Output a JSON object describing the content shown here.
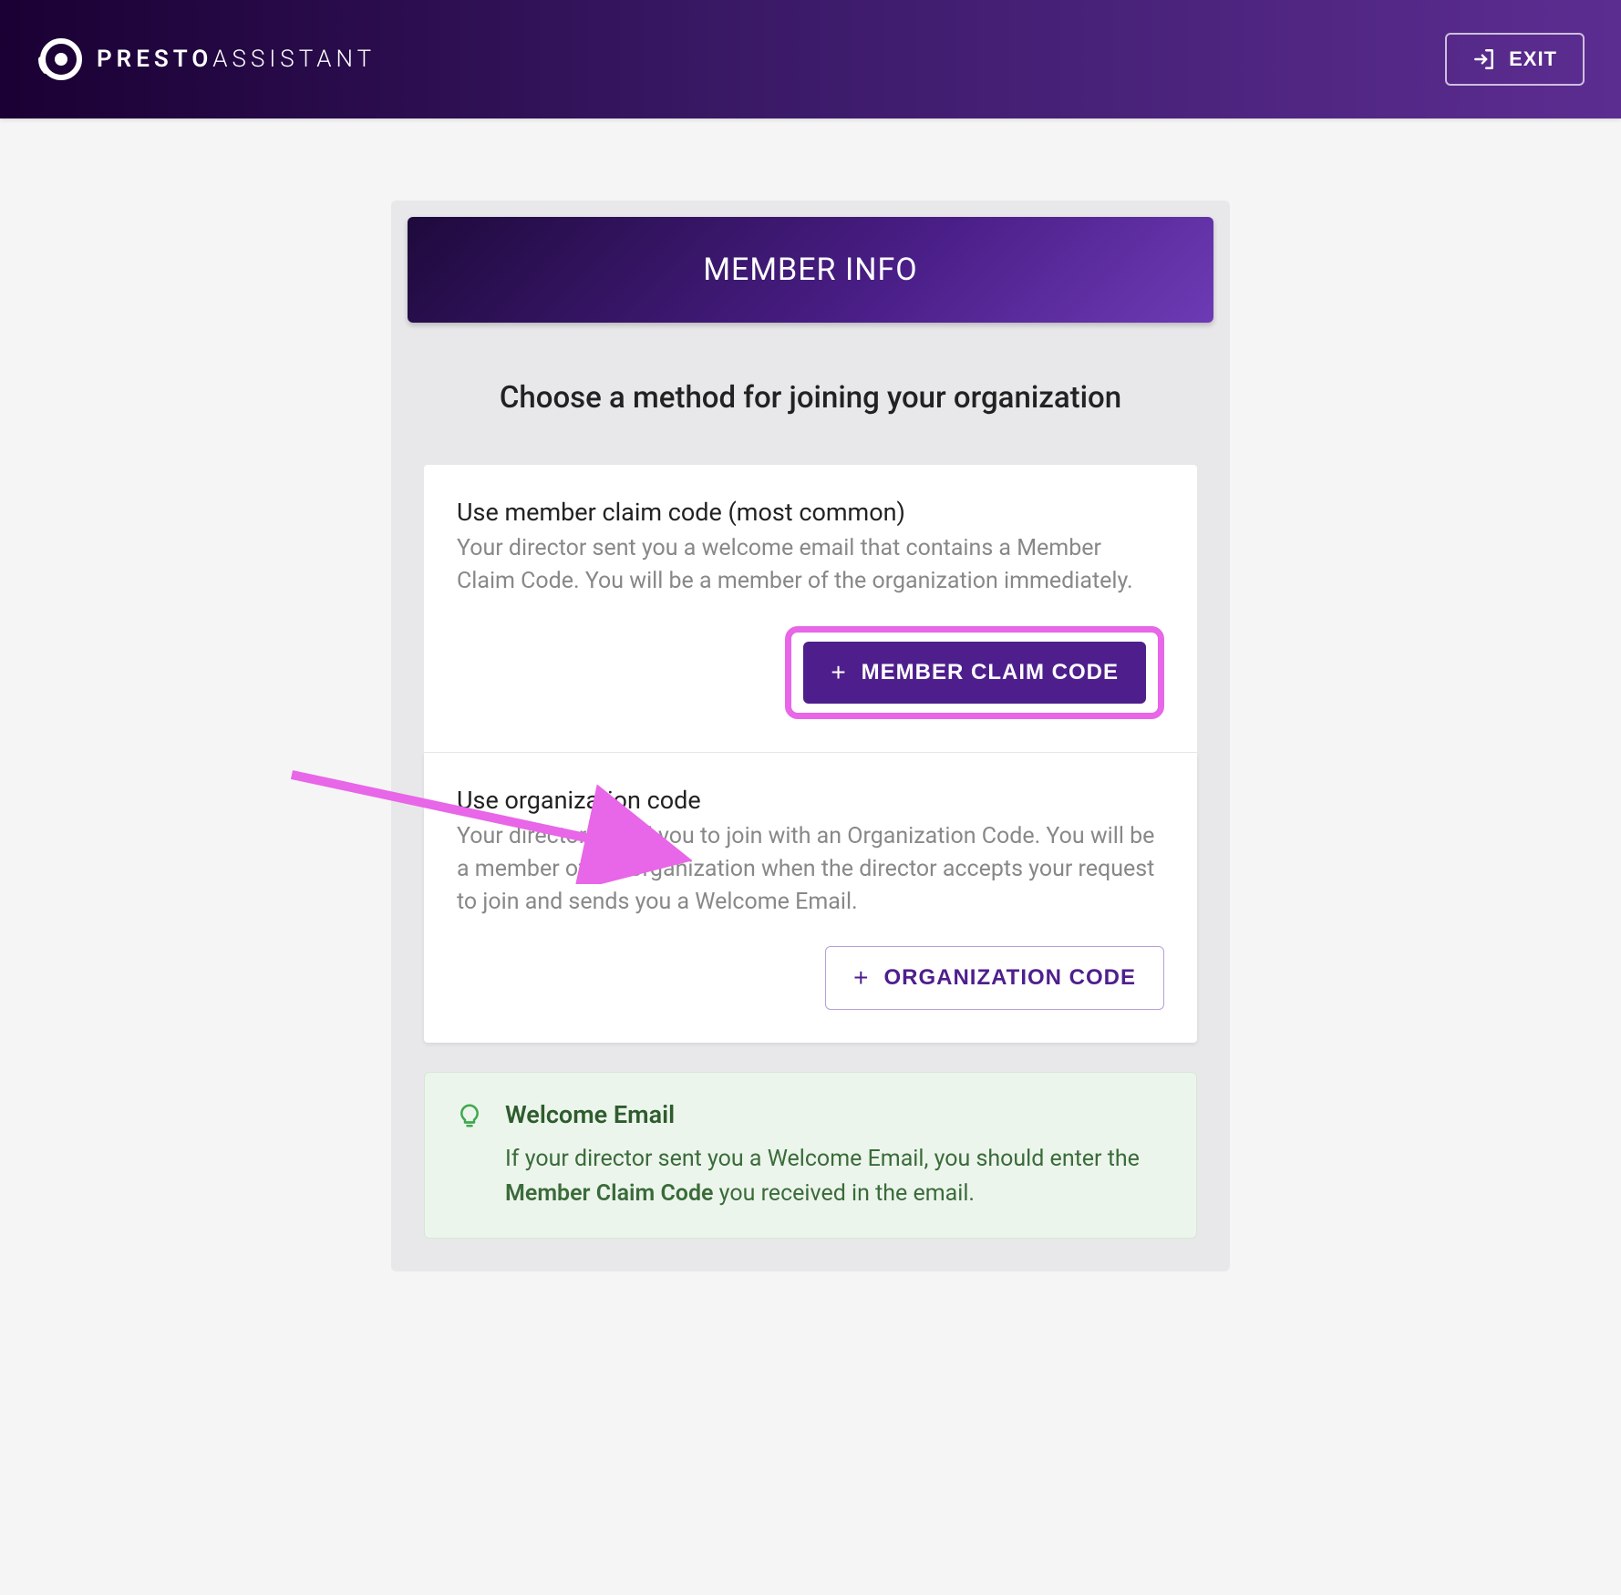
{
  "header": {
    "logo_text_bold": "PRESTO",
    "logo_text_light": "ASSISTANT",
    "exit_label": "EXIT"
  },
  "card": {
    "header_title": "MEMBER INFO",
    "subtitle": "Choose a method for joining your organization"
  },
  "options": [
    {
      "title": "Use member claim code (most common)",
      "description": "Your director sent you a welcome email that contains a Member Claim Code. You will be a member of the organization immediately.",
      "button_label": "MEMBER CLAIM CODE"
    },
    {
      "title": "Use organization code",
      "description": "Your director asked you to join with an Organization Code. You will be a member of the organization when the director accepts your request to join and sends you a Welcome Email.",
      "button_label": "ORGANIZATION CODE"
    }
  ],
  "tip": {
    "title": "Welcome Email",
    "text_before": "If your director sent you a Welcome Email, you should enter the ",
    "text_bold": "Member Claim Code",
    "text_after": " you received in the email."
  },
  "colors": {
    "annotation": "#e866e8"
  }
}
